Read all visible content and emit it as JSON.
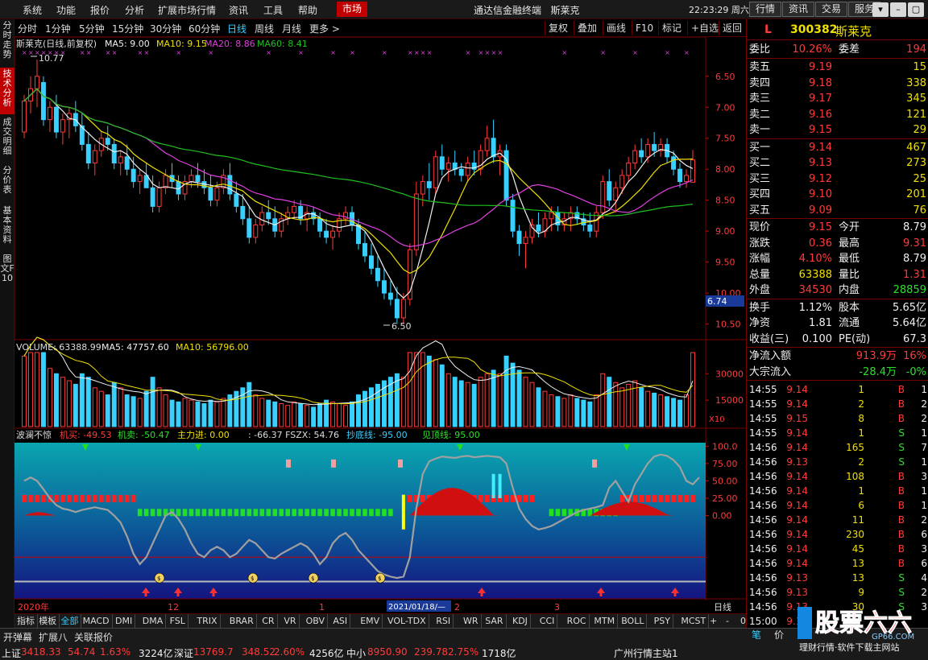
{
  "menubar": {
    "items": [
      "系统",
      "功能",
      "报价",
      "分析",
      "扩展市场行情",
      "资讯",
      "工具",
      "帮助"
    ],
    "market_tab": "市场",
    "app_title": "通达信金融终端",
    "stock_title": "斯莱克",
    "clock": "22:23:29 周六",
    "tool_buttons": [
      "行情",
      "资讯",
      "交易",
      "服务"
    ],
    "window_buttons": [
      "▾",
      "–",
      "▢",
      "✕"
    ]
  },
  "left_tabs": [
    "分时走势",
    "技术分析",
    "成交明细",
    "分价表",
    "基本资料",
    "图文F10"
  ],
  "period_bar": {
    "items": [
      "分时",
      "1分钟",
      "5分钟",
      "15分钟",
      "30分钟",
      "60分钟",
      "日线",
      "周线",
      "月线",
      "更多 >"
    ],
    "active": "日线",
    "right_buttons": [
      "复权",
      "叠加",
      "画线",
      "F10",
      "标记",
      "+自选",
      "返回"
    ]
  },
  "main_chart": {
    "legend_name": "斯莱克(日线,前复权)",
    "ma5": "MA5: 9.00",
    "ma10": "MA10: 9.15",
    "ma20": "MA20: 8.86",
    "ma60": "MA60: 8.41",
    "high_label": "10.77",
    "low_label": "6.50",
    "cursor_price": "6.74",
    "y_ticks": [
      "10.50",
      "10.00",
      "9.50",
      "9.00",
      "8.50",
      "8.00",
      "7.50",
      "7.00",
      "6.50"
    ]
  },
  "volume_chart": {
    "legend": "VOLUME: 63388.99",
    "ma5": "MA5: 47757.60",
    "ma10": "MA10: 56796.00",
    "y_ticks": [
      "30000",
      "15000"
    ],
    "unit": "X10"
  },
  "indicator_chart": {
    "name": "波澜不惊",
    "jimai": "机买: -49.53",
    "jimai2": "机卖: -50.47",
    "zhuli": "主力进: 0.00",
    "fszx": ": -66.37 FSZX: 54.76",
    "chaodi": "抄底线: -95.00",
    "jianding": "见顶线: 95.00",
    "y_ticks": [
      "100.0",
      "75.00",
      "50.00",
      "25.00",
      "0.00"
    ]
  },
  "time_axis": {
    "labels": [
      "2020年",
      "12",
      "1",
      "2021/01/18/—",
      "2",
      "3"
    ],
    "period": "日线",
    "zoom_buttons": [
      "+",
      "-",
      "0"
    ]
  },
  "bottom_tabs": [
    "指标",
    "模板",
    "全部",
    "MACD",
    "DMI",
    "DMA",
    "FSL",
    "TRIX",
    "BRAR",
    "CR",
    "VR",
    "OBV",
    "ASI",
    "EMV",
    "VOL-TDX",
    "RSI",
    "WR",
    "SAR",
    "KDJ",
    "CCI",
    "ROC",
    "MTM",
    "BOLL",
    "PSY",
    "MCST"
  ],
  "bottom_active": "全部",
  "status": {
    "row1": [
      "开弹幕",
      "扩展八",
      "关联报价"
    ],
    "sh_label": "上证",
    "sh_val": "3418.33",
    "sh_chg": "54.74",
    "sh_pct": "1.63%",
    "sh_amt": "3224亿",
    "sz_label": "深证",
    "sz_val": "13769.7",
    "sz_chg": "348.52",
    "sz_pct": "2.60%",
    "sz_amt": "4256亿",
    "zx_label": "中小",
    "zx_val": "8950.90",
    "zx_chg": "239.78",
    "zx_pct": "2.75%",
    "zx_amt": "1718亿",
    "server": "广州行情主站1"
  },
  "quote": {
    "flag": "L",
    "code": "300382",
    "name": "斯莱克",
    "weibi_label": "委比",
    "weibi": "10.26%",
    "weicha_label": "委差",
    "weicha": "194",
    "asks": [
      {
        "label": "卖五",
        "price": "9.19",
        "vol": "15"
      },
      {
        "label": "卖四",
        "price": "9.18",
        "vol": "338"
      },
      {
        "label": "卖三",
        "price": "9.17",
        "vol": "345"
      },
      {
        "label": "卖二",
        "price": "9.16",
        "vol": "121"
      },
      {
        "label": "卖一",
        "price": "9.15",
        "vol": "29"
      }
    ],
    "bids": [
      {
        "label": "买一",
        "price": "9.14",
        "vol": "467"
      },
      {
        "label": "买二",
        "price": "9.13",
        "vol": "273"
      },
      {
        "label": "买三",
        "price": "9.12",
        "vol": "25"
      },
      {
        "label": "买四",
        "price": "9.10",
        "vol": "201"
      },
      {
        "label": "买五",
        "price": "9.09",
        "vol": "76"
      }
    ],
    "stats": [
      {
        "l1": "现价",
        "v1": "9.15",
        "l2": "今开",
        "v2": "8.79",
        "c1": "red",
        "c2": "white"
      },
      {
        "l1": "涨跌",
        "v1": "0.36",
        "l2": "最高",
        "v2": "9.31",
        "c1": "red",
        "c2": "red"
      },
      {
        "l1": "涨幅",
        "v1": "4.10%",
        "l2": "最低",
        "v2": "8.79",
        "c1": "red",
        "c2": "white"
      },
      {
        "l1": "总量",
        "v1": "63388",
        "l2": "量比",
        "v2": "1.31",
        "c1": "yellow",
        "c2": "red"
      },
      {
        "l1": "外盘",
        "v1": "34530",
        "l2": "内盘",
        "v2": "28859",
        "c1": "red",
        "c2": "green"
      }
    ],
    "stats2": [
      {
        "l1": "换手",
        "v1": "1.12%",
        "l2": "股本",
        "v2": "5.65亿"
      },
      {
        "l1": "净资",
        "v1": "1.81",
        "l2": "流通",
        "v2": "5.64亿"
      },
      {
        "l1": "收益(三)",
        "v1": "0.100",
        "l2": "PE(动)",
        "v2": "67.3"
      }
    ],
    "flows": [
      {
        "label": "净流入额",
        "val": "913.9万",
        "pct": "16%",
        "color": "red"
      },
      {
        "label": "大宗流入",
        "val": "-28.4万",
        "pct": "-0%",
        "color": "green"
      }
    ],
    "ticks": [
      {
        "t": "14:55",
        "p": "9.14",
        "v": "1",
        "d": "B",
        "n": "1"
      },
      {
        "t": "14:55",
        "p": "9.14",
        "v": "2",
        "d": "B",
        "n": "2"
      },
      {
        "t": "14:55",
        "p": "9.15",
        "v": "8",
        "d": "B",
        "n": "2"
      },
      {
        "t": "14:55",
        "p": "9.14",
        "v": "1",
        "d": "S",
        "n": "1"
      },
      {
        "t": "14:56",
        "p": "9.14",
        "v": "165",
        "d": "S",
        "n": "7"
      },
      {
        "t": "14:56",
        "p": "9.13",
        "v": "2",
        "d": "S",
        "n": "1"
      },
      {
        "t": "14:56",
        "p": "9.14",
        "v": "108",
        "d": "B",
        "n": "3"
      },
      {
        "t": "14:56",
        "p": "9.14",
        "v": "1",
        "d": "B",
        "n": "1"
      },
      {
        "t": "14:56",
        "p": "9.14",
        "v": "6",
        "d": "B",
        "n": "1"
      },
      {
        "t": "14:56",
        "p": "9.14",
        "v": "11",
        "d": "B",
        "n": "2"
      },
      {
        "t": "14:56",
        "p": "9.14",
        "v": "230",
        "d": "B",
        "n": "6"
      },
      {
        "t": "14:56",
        "p": "9.14",
        "v": "45",
        "d": "B",
        "n": "3"
      },
      {
        "t": "14:56",
        "p": "9.14",
        "v": "13",
        "d": "B",
        "n": "6"
      },
      {
        "t": "14:56",
        "p": "9.13",
        "v": "13",
        "d": "S",
        "n": "4"
      },
      {
        "t": "14:56",
        "p": "9.13",
        "v": "9",
        "d": "S",
        "n": "2"
      },
      {
        "t": "14:56",
        "p": "9.13",
        "v": "30",
        "d": "S",
        "n": "3"
      },
      {
        "t": "15:00",
        "p": "9.15",
        "v": "",
        "d": "",
        "n": ""
      }
    ],
    "bottom_tabs": [
      "笔",
      "价"
    ]
  },
  "logo": {
    "main": "股票六六",
    "sub": "GP66.COM",
    "tagline": "理财行情·软件下载主网站"
  },
  "colors": {
    "up": "#ff3b3b",
    "down": "#38d0ff",
    "ma5": "#f0f0f0",
    "ma10": "#f0e000",
    "ma20": "#e040e0",
    "ma60": "#20c020",
    "brand": "#c00000"
  },
  "chart_data": [
    {
      "type": "candlestick",
      "title": "斯莱克(日线,前复权)",
      "ylim": [
        6.3,
        10.9
      ],
      "y_ticks": [
        6.5,
        7.0,
        7.5,
        8.0,
        8.5,
        9.0,
        9.5,
        10.0,
        10.5
      ],
      "ohlc": [
        [
          9.6,
          10.2,
          9.5,
          10.1
        ],
        [
          10.1,
          10.5,
          9.9,
          10.3
        ],
        [
          10.3,
          10.77,
          10.0,
          10.5
        ],
        [
          10.4,
          10.5,
          9.7,
          9.8
        ],
        [
          9.8,
          10.1,
          9.6,
          10.0
        ],
        [
          10.0,
          10.2,
          9.5,
          9.6
        ],
        [
          9.6,
          9.9,
          9.4,
          9.8
        ],
        [
          9.8,
          10.0,
          9.5,
          9.9
        ],
        [
          9.9,
          10.1,
          9.6,
          9.7
        ],
        [
          9.7,
          9.9,
          9.3,
          9.4
        ],
        [
          9.4,
          9.6,
          9.0,
          9.1
        ],
        [
          9.1,
          9.4,
          8.9,
          9.3
        ],
        [
          9.3,
          9.6,
          9.2,
          9.5
        ],
        [
          9.5,
          9.7,
          9.3,
          9.4
        ],
        [
          9.4,
          9.5,
          9.0,
          9.1
        ],
        [
          9.1,
          9.3,
          8.9,
          9.2
        ],
        [
          9.2,
          9.4,
          8.9,
          9.0
        ],
        [
          9.0,
          9.2,
          8.7,
          8.8
        ],
        [
          8.8,
          9.0,
          8.6,
          8.9
        ],
        [
          8.9,
          9.1,
          8.7,
          8.7
        ],
        [
          8.7,
          8.9,
          8.3,
          8.4
        ],
        [
          8.4,
          8.8,
          8.3,
          8.7
        ],
        [
          8.7,
          9.0,
          8.6,
          8.9
        ],
        [
          8.9,
          9.1,
          8.7,
          8.8
        ],
        [
          8.8,
          8.9,
          8.5,
          8.6
        ],
        [
          8.6,
          8.9,
          8.5,
          8.8
        ],
        [
          8.8,
          9.0,
          8.7,
          8.9
        ],
        [
          8.9,
          9.1,
          8.7,
          8.8
        ],
        [
          8.8,
          9.0,
          8.6,
          8.7
        ],
        [
          8.7,
          8.9,
          8.4,
          8.5
        ],
        [
          8.5,
          8.8,
          8.4,
          8.7
        ],
        [
          8.7,
          9.0,
          8.6,
          8.9
        ],
        [
          8.9,
          9.1,
          8.5,
          8.6
        ],
        [
          8.6,
          8.8,
          8.3,
          8.4
        ],
        [
          8.4,
          8.6,
          8.1,
          8.2
        ],
        [
          8.2,
          8.4,
          7.8,
          7.9
        ],
        [
          7.9,
          8.2,
          7.8,
          8.1
        ],
        [
          8.1,
          8.4,
          8.0,
          8.3
        ],
        [
          8.3,
          8.5,
          8.1,
          8.2
        ],
        [
          8.2,
          8.4,
          7.9,
          8.0
        ],
        [
          8.0,
          8.3,
          7.9,
          8.2
        ],
        [
          8.2,
          8.4,
          8.1,
          8.3
        ],
        [
          8.3,
          8.5,
          8.2,
          8.4
        ],
        [
          8.4,
          8.5,
          8.1,
          8.2
        ],
        [
          8.2,
          8.4,
          8.0,
          8.3
        ],
        [
          8.3,
          8.4,
          8.1,
          8.2
        ],
        [
          8.2,
          8.3,
          7.9,
          8.0
        ],
        [
          8.0,
          8.2,
          7.8,
          7.9
        ],
        [
          7.9,
          8.1,
          7.7,
          8.0
        ],
        [
          8.0,
          8.3,
          7.9,
          8.2
        ],
        [
          8.2,
          8.4,
          8.1,
          8.3
        ],
        [
          8.3,
          8.4,
          8.0,
          8.1
        ],
        [
          8.1,
          8.2,
          7.7,
          7.8
        ],
        [
          7.8,
          8.0,
          7.5,
          7.6
        ],
        [
          7.6,
          7.8,
          7.3,
          7.4
        ],
        [
          7.4,
          7.6,
          7.1,
          7.2
        ],
        [
          7.2,
          7.4,
          6.9,
          7.0
        ],
        [
          7.0,
          7.2,
          6.8,
          6.9
        ],
        [
          6.9,
          7.1,
          6.5,
          6.6
        ],
        [
          6.6,
          7.0,
          6.5,
          6.9
        ],
        [
          6.9,
          7.8,
          6.8,
          7.7
        ],
        [
          7.7,
          8.8,
          7.6,
          8.6
        ],
        [
          8.6,
          8.9,
          8.4,
          8.8
        ],
        [
          8.8,
          9.1,
          8.5,
          8.7
        ],
        [
          8.7,
          9.3,
          8.6,
          9.2
        ],
        [
          9.2,
          9.4,
          8.9,
          9.0
        ],
        [
          9.0,
          9.2,
          8.8,
          9.1
        ],
        [
          9.1,
          9.3,
          8.9,
          9.0
        ],
        [
          9.0,
          9.1,
          8.8,
          8.9
        ],
        [
          8.9,
          9.2,
          8.8,
          9.1
        ],
        [
          9.1,
          9.3,
          8.9,
          9.0
        ],
        [
          9.0,
          9.4,
          8.9,
          9.3
        ],
        [
          9.3,
          9.7,
          9.2,
          9.5
        ],
        [
          9.5,
          9.8,
          9.1,
          9.2
        ],
        [
          9.2,
          9.4,
          8.9,
          9.3
        ],
        [
          9.3,
          9.4,
          8.4,
          8.5
        ],
        [
          8.5,
          8.6,
          7.9,
          8.0
        ],
        [
          8.0,
          8.1,
          7.6,
          7.8
        ],
        [
          7.8,
          8.0,
          7.4,
          7.9
        ],
        [
          7.9,
          8.2,
          7.8,
          8.1
        ],
        [
          8.1,
          8.3,
          7.9,
          8.0
        ],
        [
          8.0,
          8.3,
          7.9,
          8.2
        ],
        [
          8.2,
          8.4,
          8.0,
          8.3
        ],
        [
          8.3,
          8.4,
          8.0,
          8.1
        ],
        [
          8.1,
          8.3,
          8.0,
          8.2
        ],
        [
          8.2,
          8.4,
          8.0,
          8.3
        ],
        [
          8.3,
          8.4,
          8.1,
          8.2
        ],
        [
          8.2,
          8.3,
          8.0,
          8.1
        ],
        [
          8.1,
          8.3,
          7.9,
          8.0
        ],
        [
          8.0,
          8.4,
          7.9,
          8.3
        ],
        [
          8.3,
          8.9,
          8.2,
          8.8
        ],
        [
          8.8,
          9.0,
          8.4,
          8.5
        ],
        [
          8.5,
          8.8,
          8.3,
          8.7
        ],
        [
          8.7,
          9.0,
          8.6,
          8.9
        ],
        [
          8.9,
          9.2,
          8.8,
          9.1
        ],
        [
          9.1,
          9.4,
          9.0,
          9.3
        ],
        [
          9.3,
          9.5,
          9.1,
          9.2
        ],
        [
          9.2,
          9.5,
          9.1,
          9.4
        ],
        [
          9.4,
          9.6,
          9.2,
          9.3
        ],
        [
          9.3,
          9.5,
          9.2,
          9.4
        ],
        [
          9.4,
          9.5,
          9.1,
          9.2
        ],
        [
          9.2,
          9.3,
          8.9,
          9.0
        ],
        [
          9.0,
          9.1,
          8.7,
          8.8
        ],
        [
          8.8,
          9.0,
          8.7,
          8.9
        ],
        [
          8.79,
          9.31,
          8.79,
          9.15
        ]
      ],
      "ma_labels": [
        "MA5: 9.00",
        "MA10: 9.15",
        "MA20: 8.86",
        "MA60: 8.41"
      ]
    },
    {
      "type": "bar",
      "title": "VOLUME",
      "ylim": [
        0,
        42000
      ],
      "y_ticks": [
        15000,
        30000
      ],
      "values": [
        40000,
        52000,
        60000,
        45000,
        33000,
        30000,
        28000,
        26000,
        24000,
        30000,
        28000,
        22000,
        20000,
        18000,
        25000,
        22000,
        18000,
        17000,
        16000,
        20000,
        28000,
        22000,
        18000,
        15000,
        14000,
        16000,
        15000,
        14000,
        13000,
        15000,
        14000,
        16000,
        18000,
        20000,
        22000,
        25000,
        18000,
        16000,
        15000,
        14000,
        13000,
        12000,
        14000,
        13000,
        12000,
        11000,
        13000,
        15000,
        14000,
        13000,
        12000,
        14000,
        18000,
        20000,
        22000,
        24000,
        26000,
        28000,
        30000,
        28000,
        45000,
        70000,
        50000,
        40000,
        38000,
        35000,
        30000,
        28000,
        26000,
        25000,
        24000,
        28000,
        30000,
        32000,
        30000,
        40000,
        36000,
        32000,
        28000,
        25000,
        22000,
        20000,
        18000,
        17000,
        16000,
        18000,
        16000,
        15000,
        14000,
        18000,
        30000,
        28000,
        25000,
        22000,
        24000,
        26000,
        22000,
        20000,
        19000,
        18000,
        17000,
        16000,
        15000,
        18000,
        63388
      ]
    },
    {
      "type": "line",
      "title": "波澜不惊",
      "ylim": [
        -120,
        105
      ],
      "y_ticks": [
        0,
        25,
        50,
        75,
        100
      ],
      "values": [
        50,
        55,
        50,
        38,
        25,
        15,
        10,
        8,
        5,
        8,
        10,
        12,
        10,
        8,
        0,
        -10,
        -30,
        -55,
        -70,
        -60,
        -40,
        -20,
        0,
        5,
        -5,
        -20,
        -40,
        -55,
        -60,
        -50,
        -45,
        -50,
        -60,
        -55,
        -45,
        -35,
        -40,
        -50,
        -60,
        -62,
        -55,
        -50,
        -45,
        -40,
        -45,
        -55,
        -70,
        -60,
        -40,
        -30,
        -25,
        -35,
        -50,
        -60,
        -70,
        -80,
        -85,
        -88,
        -90,
        -88,
        -60,
        10,
        60,
        78,
        82,
        85,
        84,
        83,
        85,
        86,
        84,
        85,
        86,
        85,
        84,
        75,
        40,
        10,
        -5,
        -15,
        -20,
        -18,
        -15,
        -10,
        -5,
        0,
        5,
        8,
        10,
        12,
        15,
        40,
        50,
        35,
        20,
        45,
        60,
        75,
        85,
        88,
        86,
        80,
        70,
        50,
        45,
        55
      ]
    }
  ]
}
